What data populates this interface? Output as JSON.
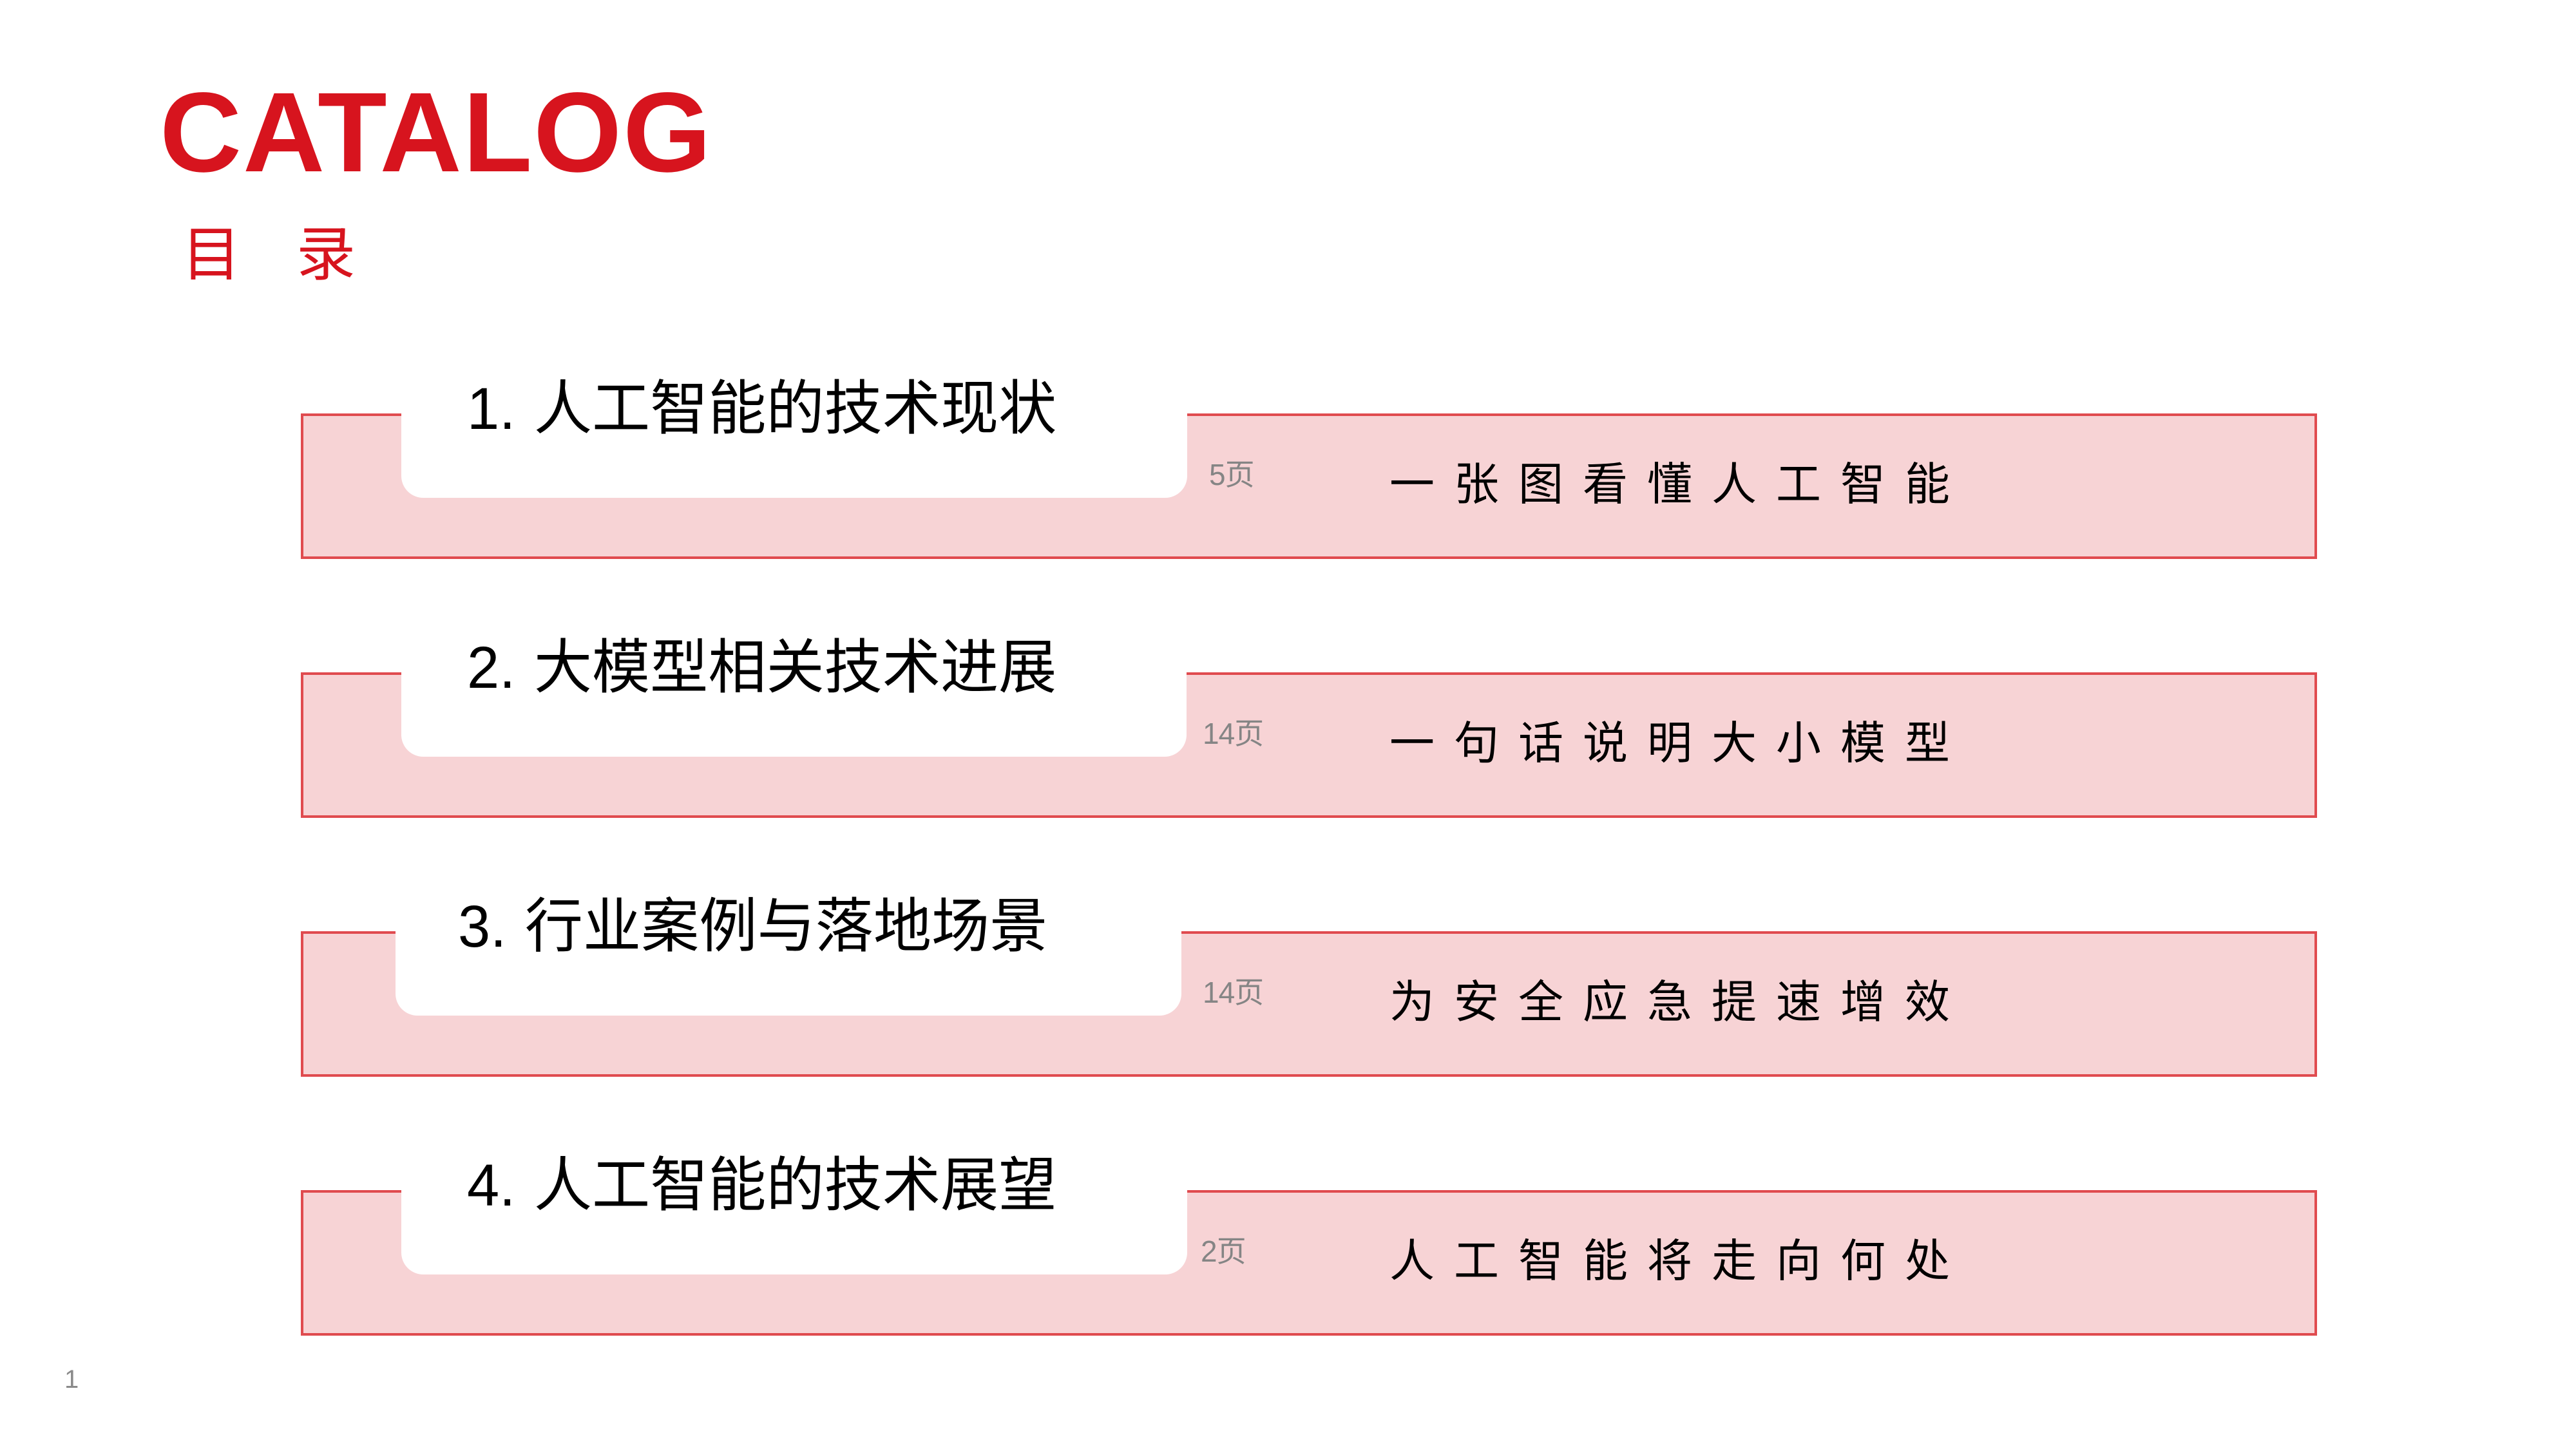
{
  "header": {
    "title": "CATALOG",
    "subtitle": "目录"
  },
  "colors": {
    "accent": "#D7141E",
    "band_fill": "#F7D3D5",
    "band_border": "#E04B4F",
    "pages_text": "#858585"
  },
  "sections": [
    {
      "number": "1.",
      "title": "人工智能的技术现状",
      "pages": "5页",
      "description": "一张图看懂人工智能"
    },
    {
      "number": "2.",
      "title": "大模型相关技术进展",
      "pages": "14页",
      "description": "一句话说明大小模型"
    },
    {
      "number": "3.",
      "title": "行业案例与落地场景",
      "pages": "14页",
      "description": "为安全应急提速增效"
    },
    {
      "number": "4.",
      "title": "人工智能的技术展望",
      "pages": "2页",
      "description": "人工智能将走向何处"
    }
  ],
  "footer": {
    "page_number": "1"
  }
}
